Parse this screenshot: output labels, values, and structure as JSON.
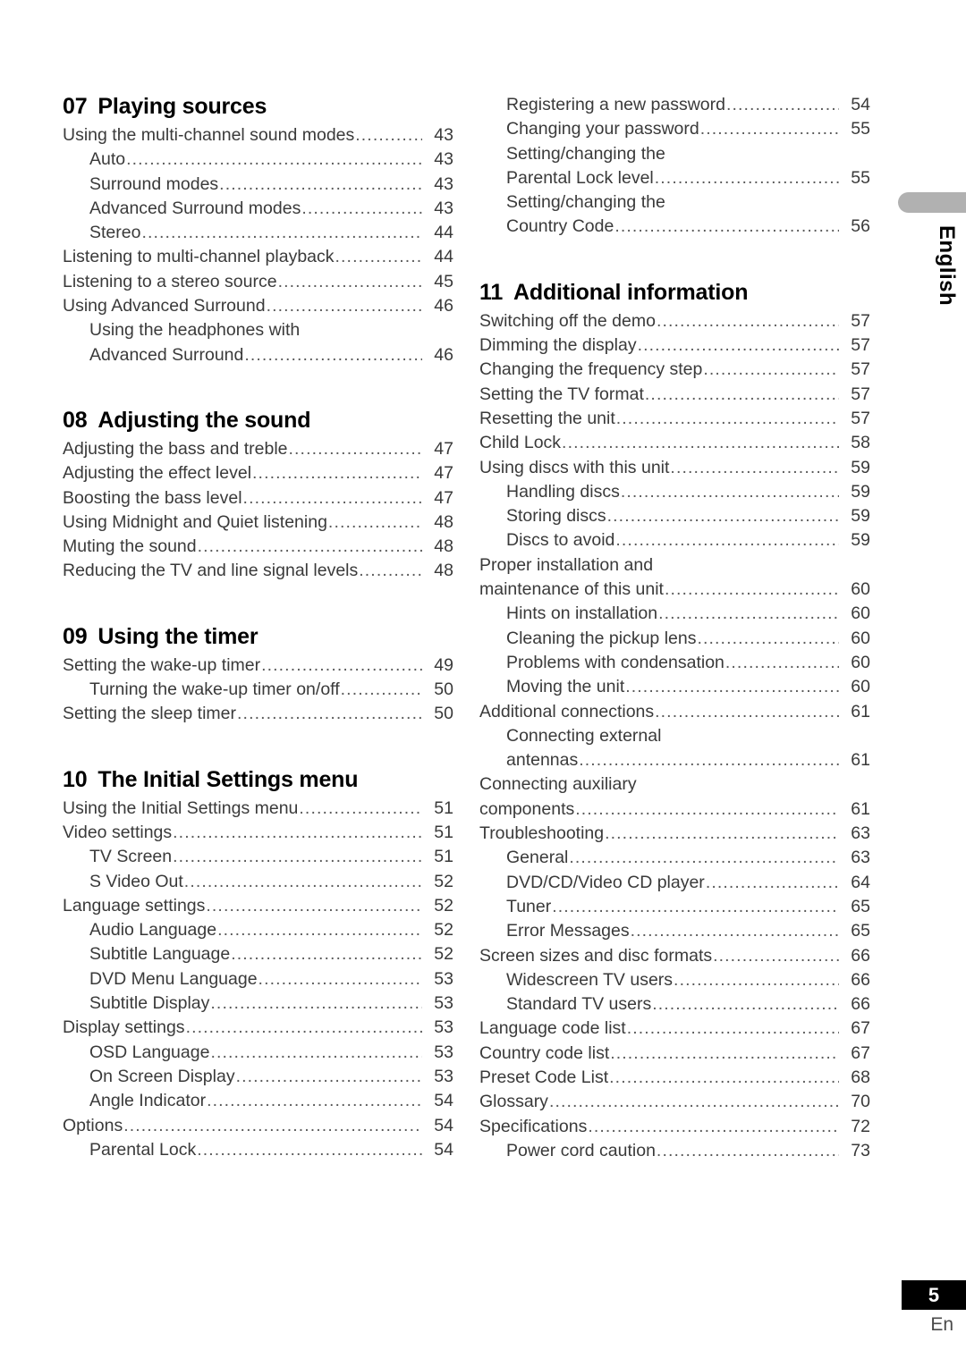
{
  "page": {
    "number": "5",
    "language_footer": "En",
    "side_tab_label": "English"
  },
  "left_column": {
    "sections": [
      {
        "number": "07",
        "title": "Playing sources",
        "entries": [
          {
            "level": 1,
            "label": "Using the multi-channel sound modes",
            "page": "43"
          },
          {
            "level": 2,
            "label": "Auto",
            "page": "43"
          },
          {
            "level": 2,
            "label": "Surround modes",
            "page": "43"
          },
          {
            "level": 2,
            "label": "Advanced Surround modes",
            "page": "43"
          },
          {
            "level": 2,
            "label": "Stereo",
            "page": "44"
          },
          {
            "level": 1,
            "label": "Listening to multi-channel playback",
            "page": "44"
          },
          {
            "level": 1,
            "label": "Listening to a stereo source",
            "page": "45"
          },
          {
            "level": 1,
            "label": "Using Advanced Surround",
            "page": "46"
          },
          {
            "level": 2,
            "label": "Using the headphones with",
            "page": ""
          },
          {
            "level": 2,
            "label": "Advanced Surround",
            "page": "46"
          }
        ]
      },
      {
        "number": "08",
        "title": "Adjusting the sound",
        "entries": [
          {
            "level": 1,
            "label": "Adjusting the bass and treble",
            "page": "47"
          },
          {
            "level": 1,
            "label": "Adjusting the effect level",
            "page": "47"
          },
          {
            "level": 1,
            "label": "Boosting the bass level",
            "page": "47"
          },
          {
            "level": 1,
            "label": "Using Midnight and Quiet listening",
            "page": "48"
          },
          {
            "level": 1,
            "label": "Muting the sound",
            "page": "48"
          },
          {
            "level": 1,
            "label": "Reducing the TV and line signal levels",
            "page": "48"
          }
        ]
      },
      {
        "number": "09",
        "title": "Using the timer",
        "entries": [
          {
            "level": 1,
            "label": "Setting the wake-up timer",
            "page": "49"
          },
          {
            "level": 2,
            "label": "Turning the wake-up timer on/off",
            "page": "50"
          },
          {
            "level": 1,
            "label": "Setting the sleep timer",
            "page": "50"
          }
        ]
      },
      {
        "number": "10",
        "title": "The Initial Settings menu",
        "entries": [
          {
            "level": 1,
            "label": "Using the Initial Settings menu",
            "page": "51"
          },
          {
            "level": 1,
            "label": "Video settings",
            "page": "51"
          },
          {
            "level": 2,
            "label": "TV Screen",
            "page": "51"
          },
          {
            "level": 2,
            "label": "S Video Out",
            "page": "52"
          },
          {
            "level": 1,
            "label": "Language settings",
            "page": "52"
          },
          {
            "level": 2,
            "label": "Audio Language",
            "page": "52"
          },
          {
            "level": 2,
            "label": "Subtitle Language",
            "page": "52"
          },
          {
            "level": 2,
            "label": "DVD Menu Language",
            "page": "53"
          },
          {
            "level": 2,
            "label": "Subtitle Display",
            "page": "53"
          },
          {
            "level": 1,
            "label": "Display settings",
            "page": "53"
          },
          {
            "level": 2,
            "label": "OSD Language",
            "page": "53"
          },
          {
            "level": 2,
            "label": "On Screen Display",
            "page": "53"
          },
          {
            "level": 2,
            "label": "Angle Indicator",
            "page": "54"
          },
          {
            "level": 1,
            "label": "Options",
            "page": "54"
          },
          {
            "level": 2,
            "label": "Parental Lock",
            "page": "54"
          }
        ]
      }
    ]
  },
  "right_column": {
    "continuation_entries": [
      {
        "level": 2,
        "label": "Registering a new password",
        "page": "54"
      },
      {
        "level": 2,
        "label": "Changing your password",
        "page": "55"
      },
      {
        "level": 2,
        "label": "Setting/changing the",
        "page": ""
      },
      {
        "level": 2,
        "label": "Parental Lock level",
        "page": "55"
      },
      {
        "level": 2,
        "label": "Setting/changing the",
        "page": ""
      },
      {
        "level": 2,
        "label": "Country Code",
        "page": "56"
      }
    ],
    "sections": [
      {
        "number": "11",
        "title": "Additional information",
        "entries": [
          {
            "level": 1,
            "label": "Switching off the demo",
            "page": "57"
          },
          {
            "level": 1,
            "label": "Dimming the display",
            "page": "57"
          },
          {
            "level": 1,
            "label": "Changing the frequency step",
            "page": "57"
          },
          {
            "level": 1,
            "label": "Setting the TV format",
            "page": "57"
          },
          {
            "level": 1,
            "label": "Resetting the unit",
            "page": "57"
          },
          {
            "level": 1,
            "label": "Child Lock",
            "page": "58"
          },
          {
            "level": 1,
            "label": "Using discs with this unit",
            "page": "59"
          },
          {
            "level": 2,
            "label": "Handling discs",
            "page": "59"
          },
          {
            "level": 2,
            "label": "Storing discs",
            "page": "59"
          },
          {
            "level": 2,
            "label": "Discs to avoid",
            "page": "59"
          },
          {
            "level": 1,
            "label": "Proper installation and",
            "page": ""
          },
          {
            "level": 1,
            "label": "maintenance of this unit",
            "page": "60"
          },
          {
            "level": 2,
            "label": "Hints on installation",
            "page": "60"
          },
          {
            "level": 2,
            "label": "Cleaning the pickup lens",
            "page": "60"
          },
          {
            "level": 2,
            "label": "Problems with condensation",
            "page": "60"
          },
          {
            "level": 2,
            "label": "Moving the unit",
            "page": "60"
          },
          {
            "level": 1,
            "label": "Additional connections",
            "page": "61"
          },
          {
            "level": 2,
            "label": "Connecting external",
            "page": ""
          },
          {
            "level": 2,
            "label": "antennas",
            "page": "61"
          },
          {
            "level": 1,
            "label": "Connecting auxiliary",
            "page": ""
          },
          {
            "level": 1,
            "label": "components",
            "page": "61"
          },
          {
            "level": 1,
            "label": "Troubleshooting",
            "page": "63"
          },
          {
            "level": 2,
            "label": "General",
            "page": "63"
          },
          {
            "level": 2,
            "label": "DVD/CD/Video CD player",
            "page": "64"
          },
          {
            "level": 2,
            "label": "Tuner",
            "page": "65"
          },
          {
            "level": 2,
            "label": "Error Messages",
            "page": "65"
          },
          {
            "level": 1,
            "label": "Screen sizes and disc formats",
            "page": "66"
          },
          {
            "level": 2,
            "label": "Widescreen TV users",
            "page": "66"
          },
          {
            "level": 2,
            "label": "Standard TV users",
            "page": "66"
          },
          {
            "level": 1,
            "label": "Language code list",
            "page": "67"
          },
          {
            "level": 1,
            "label": "Country code list",
            "page": "67"
          },
          {
            "level": 1,
            "label": "Preset Code List",
            "page": "68"
          },
          {
            "level": 1,
            "label": "Glossary",
            "page": "70"
          },
          {
            "level": 1,
            "label": "Specifications",
            "page": "72"
          },
          {
            "level": 2,
            "label": "Power cord caution",
            "page": "73"
          }
        ]
      }
    ]
  }
}
